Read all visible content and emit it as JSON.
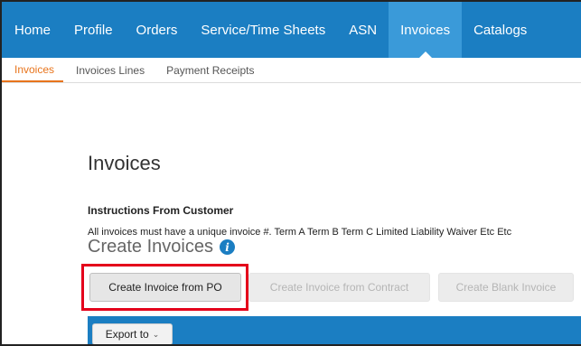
{
  "topnav": {
    "items": [
      {
        "label": "Home"
      },
      {
        "label": "Profile"
      },
      {
        "label": "Orders"
      },
      {
        "label": "Service/Time Sheets"
      },
      {
        "label": "ASN"
      },
      {
        "label": "Invoices",
        "active": true
      },
      {
        "label": "Catalogs"
      }
    ]
  },
  "subnav": {
    "items": [
      {
        "label": "Invoices",
        "active": true
      },
      {
        "label": "Invoices Lines"
      },
      {
        "label": "Payment Receipts"
      }
    ]
  },
  "page": {
    "title": "Invoices",
    "instructions_title": "Instructions From Customer",
    "instructions_text": "All invoices must have a unique invoice #. Term A Term B Term C Limited Liability Waiver Etc Etc",
    "create_title": "Create Invoices",
    "info_icon": "info-icon"
  },
  "actions": {
    "create_from_po": "Create Invoice from PO",
    "create_from_contract": "Create Invoice from Contract",
    "create_blank": "Create Blank Invoice"
  },
  "table": {
    "export_label": "Export to",
    "export_chevron": "⌄"
  },
  "colors": {
    "nav_bg": "#1b7ec2",
    "nav_active": "#3a9ad9",
    "sub_active": "#e8741c",
    "highlight": "#e4001b"
  }
}
